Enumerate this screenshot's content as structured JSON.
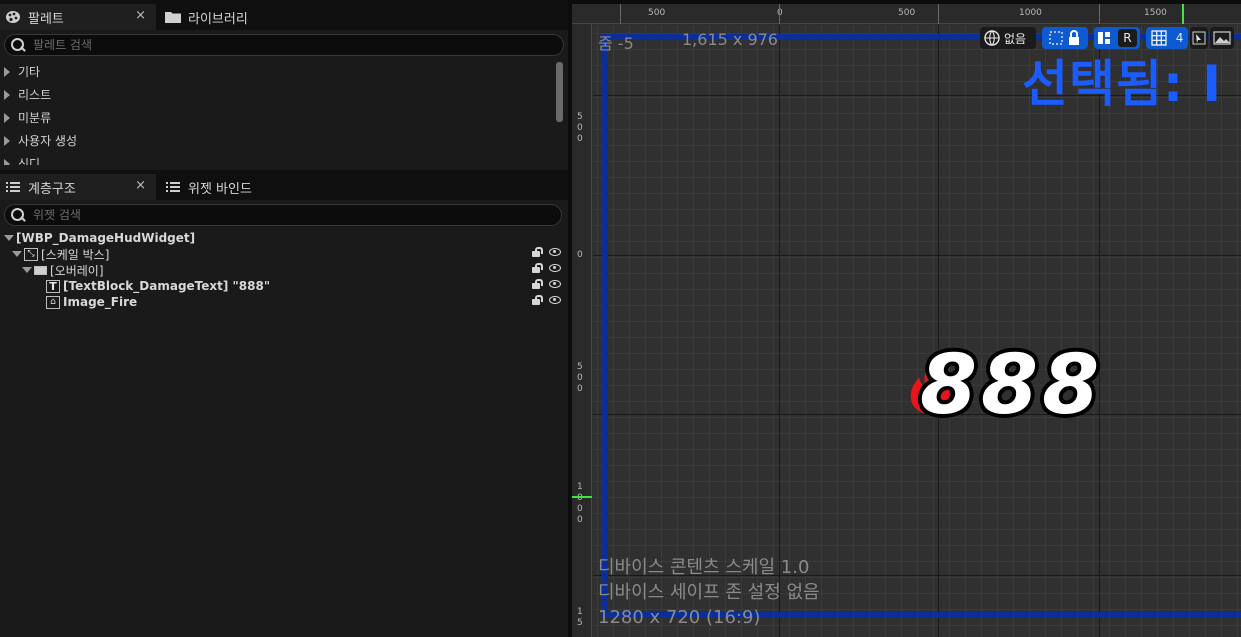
{
  "palette": {
    "tab_label": "팔레트",
    "close_glyph": "×",
    "library_tab_label": "라이브러리",
    "search_placeholder": "팔레트 검색",
    "categories": [
      "기타",
      "리스트",
      "미분류",
      "사용자 생성",
      "신디"
    ]
  },
  "hierarchy": {
    "tab_label": "계층구조",
    "close_glyph": "×",
    "bind_tab_label": "위젯 바인드",
    "search_placeholder": "위젯 검색",
    "items": [
      {
        "label": "[WBP_DamageHudWidget]"
      },
      {
        "label": "[스케일 박스]"
      },
      {
        "label": "[오버레이]"
      },
      {
        "label": "[TextBlock_DamageText] \"888\""
      },
      {
        "label": "Image_Fire"
      }
    ]
  },
  "designer": {
    "zoom_label": "줌 -5",
    "resolution_label": "1,615 x 976",
    "selected_label": "선택됨: I",
    "ruler_top": [
      "500",
      "0",
      "500",
      "1000",
      "1500"
    ],
    "ruler_left": [
      "5\n0\n0",
      "0",
      "5\n0\n0",
      "1\n0\n0\n0",
      "1\n5"
    ],
    "toolbar": {
      "world_label": "없음",
      "r_label": "R",
      "grid_value": "4"
    },
    "damage_text": "888",
    "device_scale": "디바이스 콘텐츠 스케일 1.0",
    "safe_zone": "디바이스 세이프 존 설정 없음",
    "screen_size": "1280 x 720 (16:9)"
  },
  "colors": {
    "accent_blue": "#1a5cff",
    "frame_blue": "#0a2f9a",
    "toolbar_blue": "#0e5ad0",
    "fire_red": "#e8141c"
  }
}
